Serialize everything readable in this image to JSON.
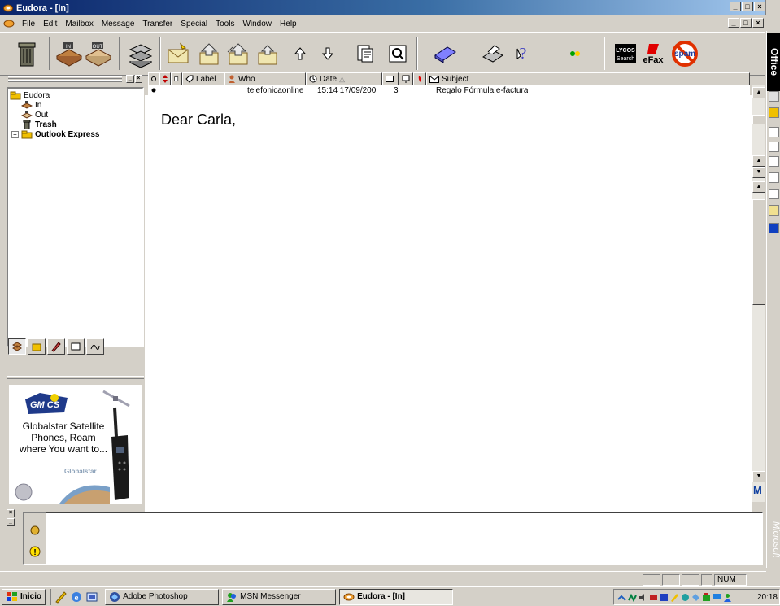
{
  "window": {
    "title": "Eudora - [In]",
    "controls": [
      "_",
      "□",
      "×"
    ]
  },
  "menubar": {
    "items": [
      "File",
      "Edit",
      "Mailbox",
      "Message",
      "Transfer",
      "Special",
      "Tools",
      "Window",
      "Help"
    ]
  },
  "toolbar": {
    "buttons": [
      "trash-button",
      "check-mail-in-button",
      "send-queued-out-button",
      "mailbox-button",
      "new-message-button",
      "reply-button",
      "reply-all-button",
      "forward-button",
      "previous-message-button",
      "next-message-button",
      "attach-button",
      "find-button",
      "address-book-button",
      "print-button",
      "help-button",
      "filter-button"
    ],
    "promo_labels": {
      "lycos": "LYCOS Search",
      "efax": "eFax",
      "spam": "spam"
    }
  },
  "mailbox_tree": {
    "root": "Eudora",
    "items": [
      {
        "label": "In",
        "bold": false
      },
      {
        "label": "Out",
        "bold": false
      },
      {
        "label": "Trash",
        "bold": true
      },
      {
        "label": "Outlook Express",
        "bold": true
      }
    ]
  },
  "message_list": {
    "columns": [
      "Label",
      "Who",
      "Date",
      "Subject"
    ],
    "rows": [
      {
        "who": "telefonicaonline",
        "date": "15:14 17/09/200",
        "size": "3",
        "subject": "Regalo Fórmula e-factura"
      }
    ]
  },
  "preview": {
    "body": "Dear Carla,"
  },
  "ad": {
    "logo": "GM CS",
    "text": "Globalstar Satellite Phones, Roam where You want to...",
    "brand": "Globalstar"
  },
  "office_bar": {
    "label": "Office",
    "vendor": "Microsoft"
  },
  "status_bar": {
    "num": "NUM"
  },
  "taskbar": {
    "start": "Inicio",
    "tasks": [
      {
        "label": "Adobe Photoshop",
        "active": false
      },
      {
        "label": "MSN Messenger",
        "active": false
      },
      {
        "label": "Eudora - [In]",
        "active": true
      }
    ],
    "clock": "20:18"
  }
}
